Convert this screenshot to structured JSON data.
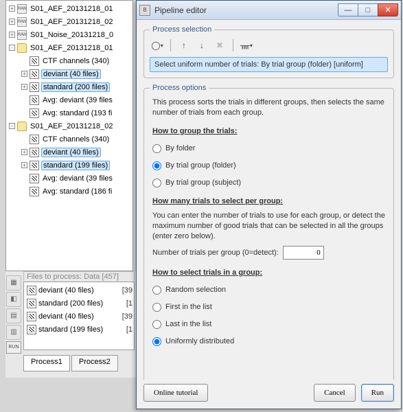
{
  "tree": [
    {
      "indent": 0,
      "expand": "+",
      "icon": "raw",
      "label": "S01_AEF_20131218_01"
    },
    {
      "indent": 0,
      "expand": "+",
      "icon": "raw",
      "label": "S01_AEF_20131218_02"
    },
    {
      "indent": 0,
      "expand": "+",
      "icon": "raw",
      "label": "S01_Noise_20131218_0"
    },
    {
      "indent": 0,
      "expand": "-",
      "icon": "folder",
      "label": "S01_AEF_20131218_01"
    },
    {
      "indent": 1,
      "expand": "",
      "icon": "ctf",
      "label": "CTF channels (340)"
    },
    {
      "indent": 1,
      "expand": "+",
      "icon": "data",
      "label": "deviant (40 files)",
      "sel": true
    },
    {
      "indent": 1,
      "expand": "+",
      "icon": "data",
      "label": "standard (200 files)",
      "sel": true
    },
    {
      "indent": 1,
      "expand": "",
      "icon": "data",
      "label": "Avg: deviant (39 files"
    },
    {
      "indent": 1,
      "expand": "",
      "icon": "data",
      "label": "Avg: standard (193 fi"
    },
    {
      "indent": 0,
      "expand": "-",
      "icon": "folder",
      "label": "S01_AEF_20131218_02"
    },
    {
      "indent": 1,
      "expand": "",
      "icon": "ctf",
      "label": "CTF channels (340)"
    },
    {
      "indent": 1,
      "expand": "+",
      "icon": "data",
      "label": "deviant (40 files)",
      "sel": true
    },
    {
      "indent": 1,
      "expand": "+",
      "icon": "data",
      "label": "standard (199 files)",
      "sel": true
    },
    {
      "indent": 1,
      "expand": "",
      "icon": "data",
      "label": "Avg: deviant (39 files"
    },
    {
      "indent": 1,
      "expand": "",
      "icon": "data",
      "label": "Avg: standard (186 fi"
    }
  ],
  "files": {
    "header": "Files to process: Data [457]",
    "items": [
      {
        "icon": "data",
        "label": "deviant (40 files)",
        "right": "[39"
      },
      {
        "icon": "data",
        "label": "standard (200 files)",
        "right": "[1"
      },
      {
        "icon": "data",
        "label": "deviant (40 files)",
        "right": "[39"
      },
      {
        "icon": "data",
        "label": "standard (199 files)",
        "right": "[1"
      }
    ],
    "run_label": "RUN",
    "tabs": [
      "Process1",
      "Process2"
    ]
  },
  "dialog": {
    "title": "Pipeline editor",
    "section1_legend": "Process selection",
    "selected_process": "Select uniform number of trials: By trial group (folder) [uniform]",
    "section2_legend": "Process options",
    "desc": "This process sorts the trials in different groups, then selects the same number of trials from each group.",
    "head_group": "How to group the trials:",
    "group_options": [
      "By folder",
      "By trial group (folder)",
      "By trial group (subject)"
    ],
    "group_selected": 1,
    "head_count": "How many trials to select per group:",
    "count_desc": "You can enter the number of trials to use for each group, or detect the maximum number of good trials that can be selected in all the groups (enter zero below).",
    "count_label": "Number of trials per group (0=detect):",
    "count_value": "0",
    "head_select": "How to select trials in a group:",
    "select_options": [
      "Random selection",
      "First in the list",
      "Last in the list",
      "Uniformly distributed"
    ],
    "select_selected": 3,
    "btn_tutorial": "Online tutorial",
    "btn_cancel": "Cancel",
    "btn_run": "Run"
  }
}
